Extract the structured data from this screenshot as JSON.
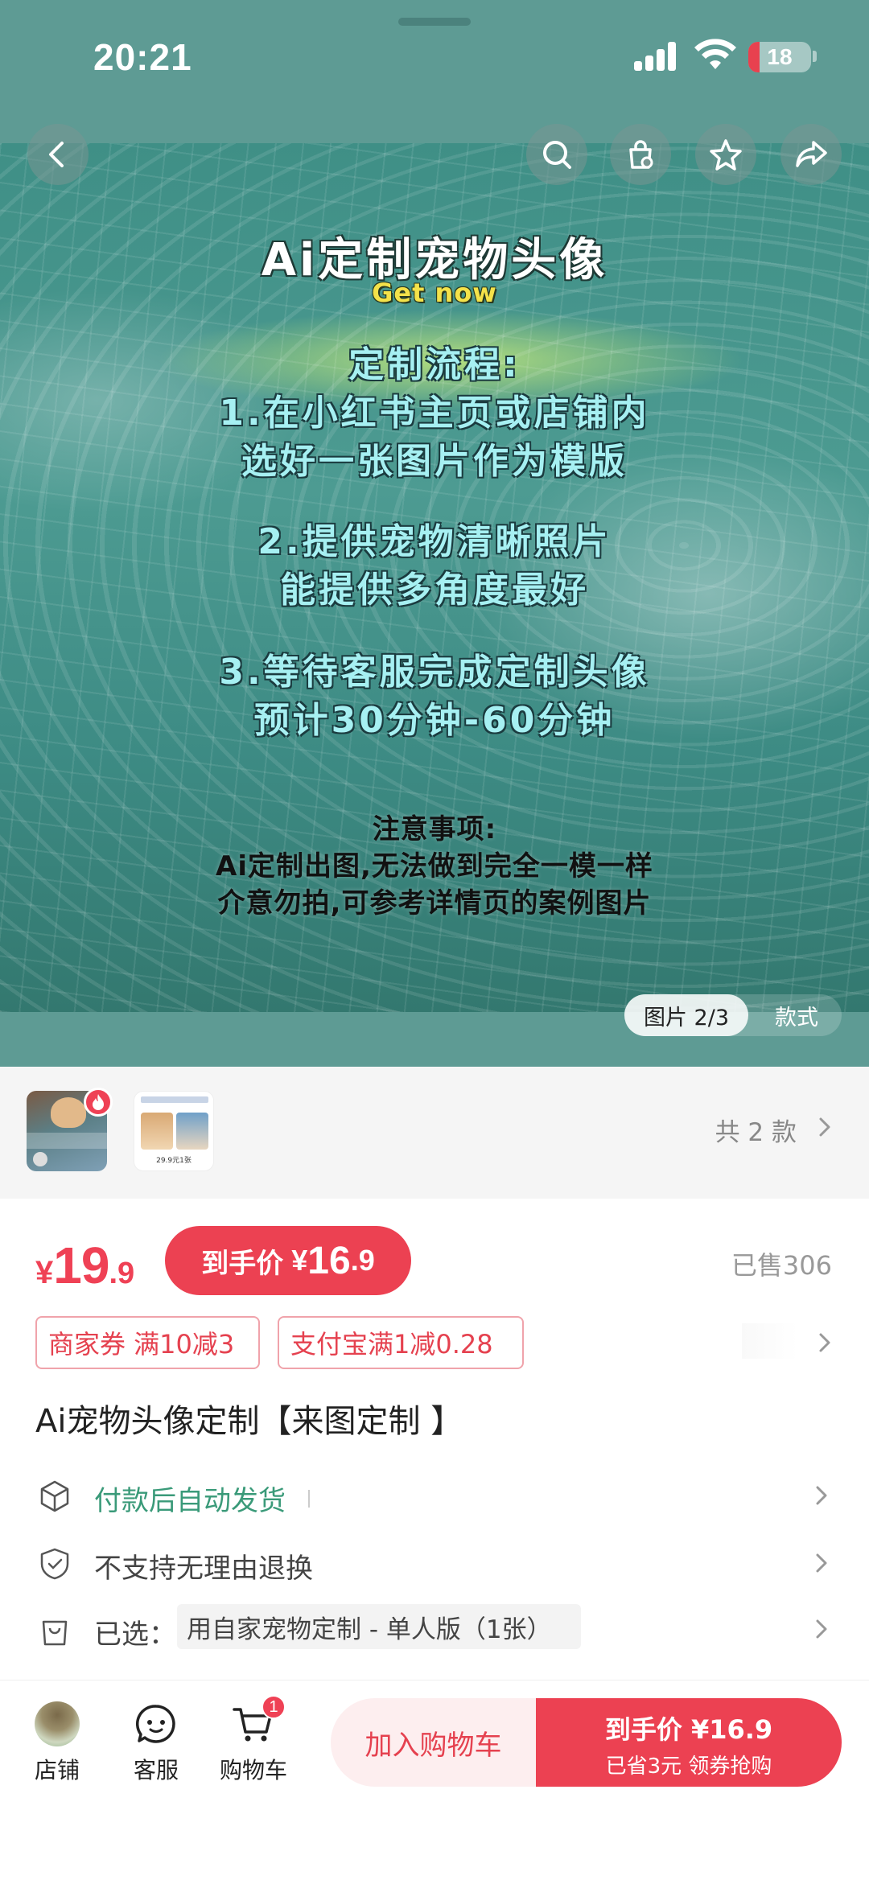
{
  "status_bar": {
    "time": "20:21",
    "battery": "18"
  },
  "hero": {
    "title": "Ai定制宠物头像",
    "subtitle": "Get now",
    "steps": [
      [
        "定制流程:",
        "1.在小红书主页或店铺内",
        "选好一张图片作为模版"
      ],
      [
        "2.提供宠物清晰照片",
        "能提供多角度最好"
      ],
      [
        "3.等待客服完成定制头像",
        "预计30分钟-60分钟"
      ]
    ],
    "notes": [
      "注意事项:",
      "Ai定制出图,无法做到完全一模一样",
      "介意勿拍,可参考详情页的案例图片"
    ],
    "pager": "图片 2/3",
    "style_tab": "款式"
  },
  "variants": {
    "thumb2_price": "29.9元1张",
    "count_label": "共 2 款"
  },
  "price": {
    "currency": "¥",
    "integer": "19",
    "decimal": ".9",
    "final_label": "到手价",
    "final_integer": "16",
    "final_decimal": ".9",
    "sold": "已售306"
  },
  "coupons": [
    "商家券 满10减3",
    "支付宝满1减0.28"
  ],
  "product_title": "Ai宠物头像定制【来图定制 】",
  "rows": {
    "delivery": "付款后自动发货",
    "returns": "不支持无理由退换",
    "selected_label": "已选：",
    "selected_value": "用自家宠物定制 - 单人版（1张）"
  },
  "bottom_bar": {
    "shop": "店铺",
    "service": "客服",
    "cart": "购物车",
    "cart_count": "1",
    "add_to_cart": "加入购物车",
    "buy_line1": "到手价 ¥16.9",
    "buy_line2": "已省3元 领券抢购"
  },
  "colors": {
    "accent": "#ec4152",
    "green": "#3a9a79",
    "hero_bg": "#5e9b94"
  }
}
